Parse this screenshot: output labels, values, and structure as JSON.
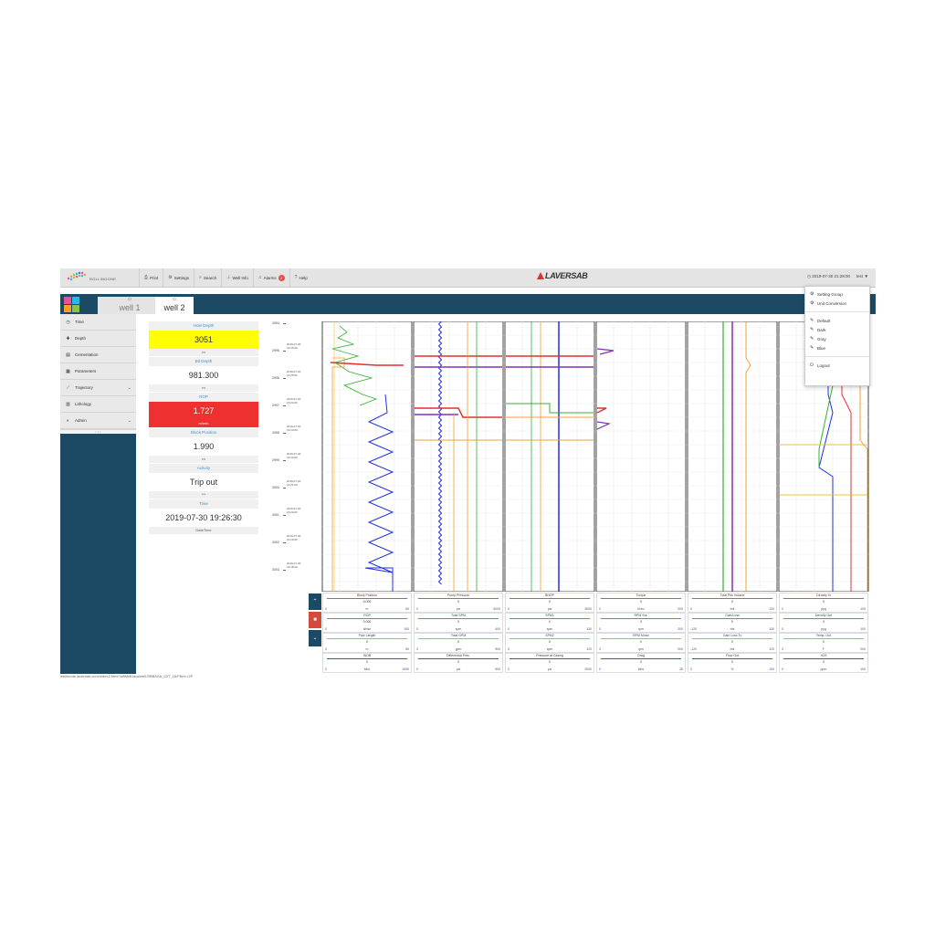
{
  "app": {
    "logo_text": "ROLLINGONE",
    "brand": "LAVERSAB",
    "datetime": "2019-07-30 21:28:00",
    "user": "test"
  },
  "menu": [
    {
      "icon": "print-icon",
      "glyph": "⎙",
      "label": "Print"
    },
    {
      "icon": "settings-icon",
      "glyph": "⚙",
      "label": "Settings"
    },
    {
      "icon": "search-icon",
      "glyph": "⌕",
      "label": "Search"
    },
    {
      "icon": "well-info-icon",
      "glyph": "⊥",
      "label": "Well Info"
    },
    {
      "icon": "alarm-icon",
      "glyph": "♫",
      "label": "Alarms",
      "badge": "2"
    },
    {
      "icon": "help-icon",
      "glyph": "?",
      "label": "Help"
    }
  ],
  "tabs": [
    {
      "label": "well 1",
      "icon": "well-icon"
    },
    {
      "label": "well 2",
      "icon": "well-icon"
    }
  ],
  "sidebar": {
    "items": [
      {
        "icon": "clock-icon",
        "glyph": "◷",
        "label": "Time"
      },
      {
        "icon": "depth-icon",
        "glyph": "✚",
        "label": "Depth"
      },
      {
        "icon": "database-icon",
        "glyph": "▤",
        "label": "Cementation"
      },
      {
        "icon": "table-icon",
        "glyph": "▦",
        "label": "Parameters"
      },
      {
        "icon": "chart-icon",
        "glyph": "⟋",
        "label": "Trajectory",
        "expand": true
      },
      {
        "icon": "lithology-icon",
        "glyph": "▥",
        "label": "Lithology"
      },
      {
        "icon": "admin-icon",
        "glyph": "◐",
        "label": "Admin",
        "expand": true
      }
    ]
  },
  "readouts": [
    {
      "label": "Hole Depth",
      "value": "3051",
      "unit": "m",
      "style": "yellow"
    },
    {
      "label": "Bit Depth",
      "value": "981.300",
      "unit": "m",
      "style": "normal"
    },
    {
      "label": "ROP",
      "value": "1.727",
      "unit": "m/min",
      "style": "red"
    },
    {
      "label": "Block Position",
      "value": "1.990",
      "unit": "m",
      "style": "normal"
    },
    {
      "label": "Activity",
      "value": "Trip out",
      "unit": "***",
      "style": "normal"
    },
    {
      "label": "Time",
      "value": "2019-07-30 19:26:30",
      "unit": "DateTime",
      "style": "normal"
    }
  ],
  "depth_axis": [
    {
      "depth": "2994",
      "time": ""
    },
    {
      "depth": "2995",
      "time": "2019-07-30 19:26:00"
    },
    {
      "depth": "2996",
      "time": "2019-07-30 19:25:00"
    },
    {
      "depth": "2997",
      "time": "2019-07-30 19:24:00"
    },
    {
      "depth": "2998",
      "time": "2019-07-30 19:23:00"
    },
    {
      "depth": "2999",
      "time": "2019-07-30 19:22:00"
    },
    {
      "depth": "3000",
      "time": "2019-07-30 19:21:00"
    },
    {
      "depth": "3001",
      "time": "2019-07-30 19:20:00"
    },
    {
      "depth": "3002",
      "time": "2019-07-30 19:19:00"
    },
    {
      "depth": "3003",
      "time": "2019-07-30 19:18:00"
    }
  ],
  "legend": {
    "buttons": [
      {
        "icon": "chevron-up-icon",
        "glyph": "⌃"
      },
      {
        "icon": "stop-icon",
        "glyph": "■"
      },
      {
        "icon": "chevron-down-icon",
        "glyph": "⌄"
      }
    ],
    "columns": [
      [
        {
          "name": "Block Position",
          "value": "0.000",
          "min": "0",
          "unit": "m",
          "max": "50",
          "color": "#e05050"
        },
        {
          "name": "ROP",
          "value": "0.000",
          "min": "0",
          "unit": "ft/min",
          "max": "100",
          "color": "#40b040"
        },
        {
          "name": "Pipe Length",
          "value": "0",
          "min": "0",
          "unit": "m",
          "max": "50",
          "color": "#e8a040"
        },
        {
          "name": "WOB",
          "value": "0",
          "min": "0",
          "unit": "klbs",
          "max": "1000",
          "color": "#4050d0"
        }
      ],
      [
        {
          "name": "Pump Pressure",
          "value": "0",
          "min": "0",
          "unit": "psi",
          "max": "5000",
          "color": "#e05050"
        },
        {
          "name": "Total SPM",
          "value": "0",
          "min": "0",
          "unit": "spm",
          "max": "400",
          "color": "#40b040"
        },
        {
          "name": "Total GPM",
          "value": "0",
          "min": "0",
          "unit": "gpm",
          "max": "900",
          "color": "#e8a040"
        },
        {
          "name": "Differential Pres.",
          "value": "0",
          "min": "0",
          "unit": "psi",
          "max": "900",
          "color": "#4050d0"
        }
      ],
      [
        {
          "name": "BHOP",
          "value": "0",
          "min": "0",
          "unit": "psi",
          "max": "3000",
          "color": "#e05050"
        },
        {
          "name": "SPM1",
          "value": "0",
          "min": "0",
          "unit": "spm",
          "max": "120",
          "color": "#40b040"
        },
        {
          "name": "SPM2",
          "value": "0",
          "min": "0",
          "unit": "spm",
          "max": "120",
          "color": "#e8a040"
        },
        {
          "name": "Pressure at Casing",
          "value": "0",
          "min": "0",
          "unit": "psi",
          "max": "2000",
          "color": "#4050d0"
        }
      ],
      [
        {
          "name": "Torque",
          "value": "0",
          "min": "0",
          "unit": "kNm",
          "max": "200",
          "color": "#e05050"
        },
        {
          "name": "RPM Sur.",
          "value": "0",
          "min": "0",
          "unit": "rpm",
          "max": "200",
          "color": "#40b040"
        },
        {
          "name": "RPM Motor",
          "value": "0",
          "min": "0",
          "unit": "rpm",
          "max": "200",
          "color": "#e8a040"
        },
        {
          "name": "Drag",
          "value": "0",
          "min": "0",
          "unit": "klbs",
          "max": "25",
          "color": "#4050d0"
        }
      ],
      [
        {
          "name": "Total Pits Volume",
          "value": "0",
          "min": "0",
          "unit": "bbl",
          "max": "120",
          "color": "#e05050"
        },
        {
          "name": "Gain/Loss",
          "value": "0",
          "min": "-120",
          "unit": "bbl",
          "max": "120",
          "color": "#40b040"
        },
        {
          "name": "Gain Loss Tv",
          "value": "0",
          "min": "-120",
          "unit": "bbl",
          "max": "120",
          "color": "#e8a040"
        },
        {
          "name": "Flow Out",
          "value": "0",
          "min": "0",
          "unit": "%",
          "max": "100",
          "color": "#4050d0"
        }
      ],
      [
        {
          "name": "Density In",
          "value": "0",
          "min": "0",
          "unit": "ppg",
          "max": "100",
          "color": "#e05050"
        },
        {
          "name": "Density Out",
          "value": "0",
          "min": "0",
          "unit": "ppg",
          "max": "100",
          "color": "#40b040"
        },
        {
          "name": "Temp. Out",
          "value": "0",
          "min": "0",
          "unit": "F",
          "max": "200",
          "color": "#e8a040"
        },
        {
          "name": "H2S",
          "value": "0",
          "min": "0",
          "unit": "ppm",
          "max": "100",
          "color": "#4050d0"
        }
      ]
    ]
  },
  "status_url": "wellmode.laversab.com/index2.html?allWellData/well-RBBASA_03T_16/Filter=/2P",
  "dropdown": {
    "items": [
      {
        "icon": "settings-icon",
        "glyph": "⚙",
        "label": "Setting Group"
      },
      {
        "icon": "settings-icon",
        "glyph": "⚙",
        "label": "Unit Conversion"
      }
    ],
    "themes": [
      {
        "icon": "brush-icon",
        "glyph": "✎",
        "label": "Default"
      },
      {
        "icon": "brush-icon",
        "glyph": "✎",
        "label": "Dark"
      },
      {
        "icon": "brush-icon",
        "glyph": "✎",
        "label": "Gray"
      },
      {
        "icon": "brush-icon",
        "glyph": "✎",
        "label": "Blue"
      }
    ],
    "logout": {
      "icon": "logout-icon",
      "glyph": "⏻",
      "label": "Logout"
    }
  }
}
